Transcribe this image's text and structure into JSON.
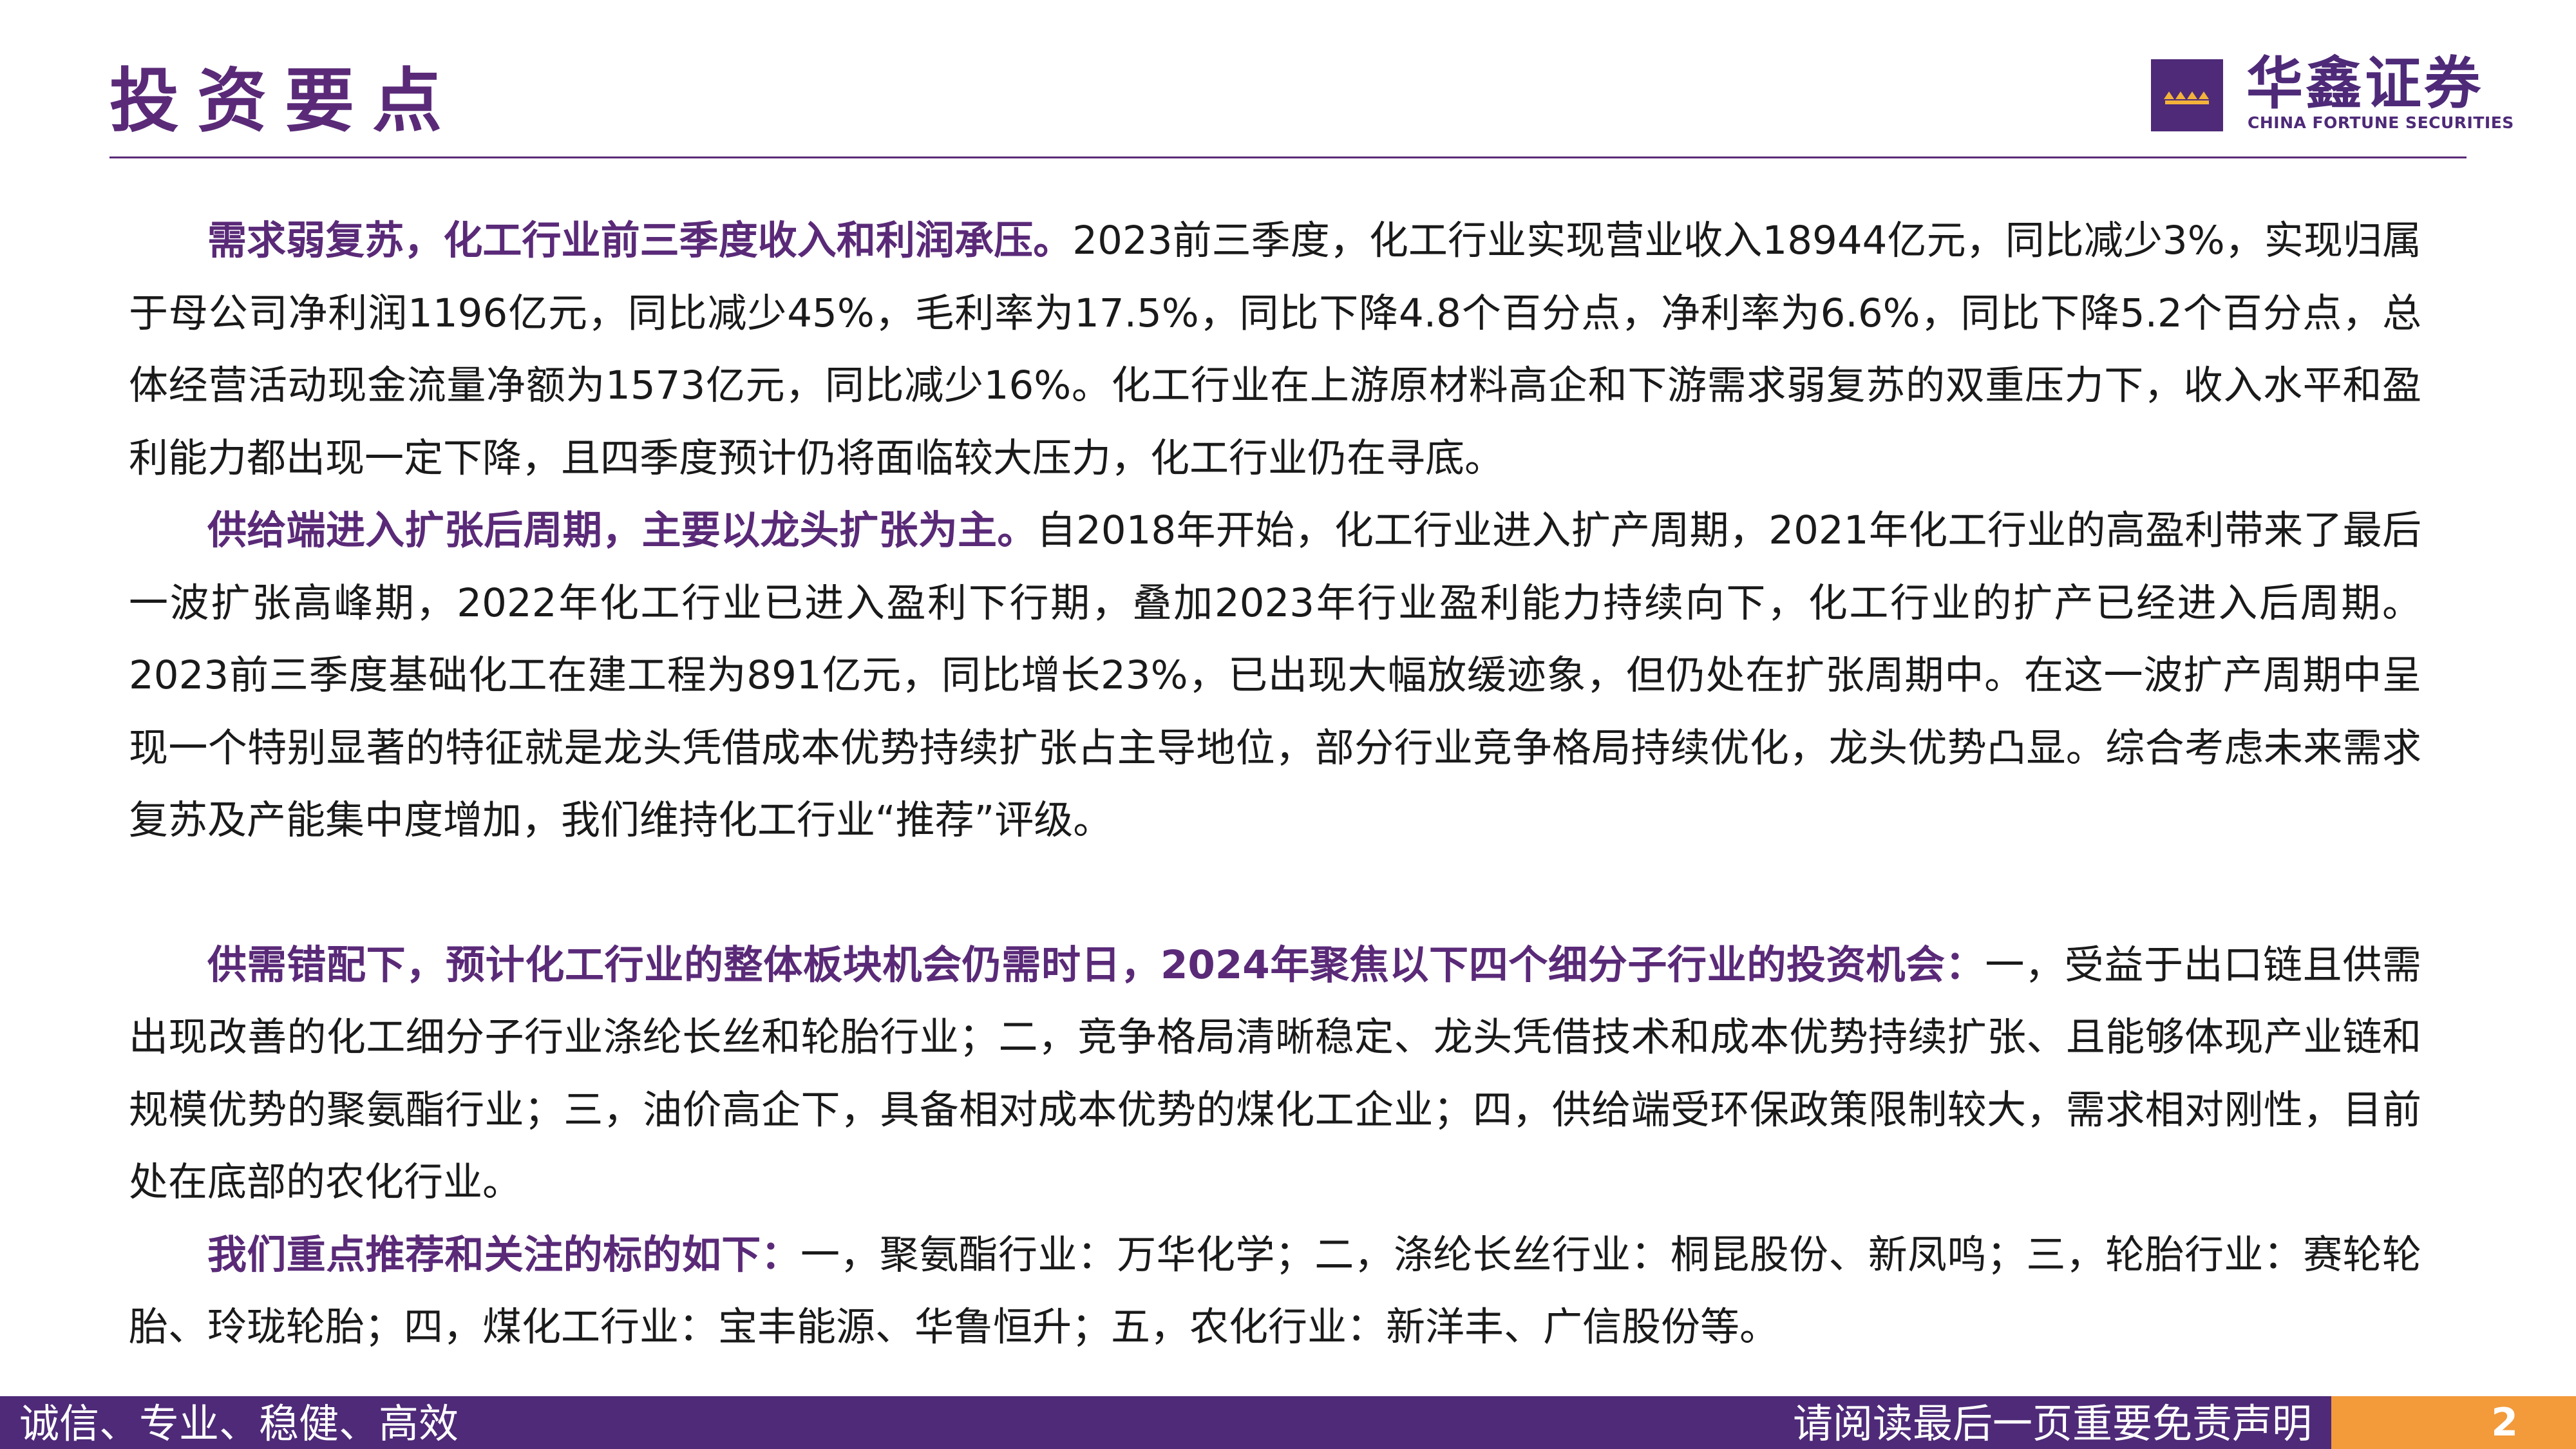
{
  "header": {
    "title": "投资要点",
    "logo_cn": "华鑫证券",
    "logo_en": "CHINA FORTUNE SECURITIES",
    "brand_color": "#4e2a78",
    "accent_color": "#f39a3a"
  },
  "paragraphs": [
    {
      "lead": "需求弱复苏，化工行业前三季度收入和利润承压。",
      "body": "2023前三季度，化工行业实现营业收入18944亿元，同比减少3%，实现归属于母公司净利润1196亿元，同比减少45%，毛利率为17.5%，同比下降4.8个百分点，净利率为6.6%，同比下降5.2个百分点，总体经营活动现金流量净额为1573亿元，同比减少16%。化工行业在上游原材料高企和下游需求弱复苏的双重压力下，收入水平和盈利能力都出现一定下降，且四季度预计仍将面临较大压力，化工行业仍在寻底。"
    },
    {
      "lead": "供给端进入扩张后周期，主要以龙头扩张为主。",
      "body": "自2018年开始，化工行业进入扩产周期，2021年化工行业的高盈利带来了最后一波扩张高峰期，2022年化工行业已进入盈利下行期，叠加2023年行业盈利能力持续向下，化工行业的扩产已经进入后周期。2023前三季度基础化工在建工程为891亿元，同比增长23%，已出现大幅放缓迹象，但仍处在扩张周期中。在这一波扩产周期中呈现一个特别显著的特征就是龙头凭借成本优势持续扩张占主导地位，部分行业竞争格局持续优化，龙头优势凸显。综合考虑未来需求复苏及产能集中度增加，我们维持化工行业“推荐”评级。"
    },
    {
      "lead": "供需错配下，预计化工行业的整体板块机会仍需时日，2024年聚焦以下四个细分子行业的投资机会：",
      "body": "一，受益于出口链且供需出现改善的化工细分子行业涤纶长丝和轮胎行业；二，竞争格局清晰稳定、龙头凭借技术和成本优势持续扩张、且能够体现产业链和规模优势的聚氨酯行业；三，油价高企下，具备相对成本优势的煤化工企业；四，供给端受环保政策限制较大，需求相对刚性，目前处在底部的农化行业。"
    },
    {
      "lead": "我们重点推荐和关注的标的如下：",
      "body": "一，聚氨酯行业：万华化学；二，涤纶长丝行业：桐昆股份、新凤鸣；三，轮胎行业：赛轮轮胎、玲珑轮胎；四，煤化工行业：宝丰能源、华鲁恒升；五，农化行业：新洋丰、广信股份等。"
    }
  ],
  "footer": {
    "slogan": "诚信、专业、稳健、高效",
    "disclaimer": "请阅读最后一页重要免责声明",
    "page_number": "2"
  }
}
